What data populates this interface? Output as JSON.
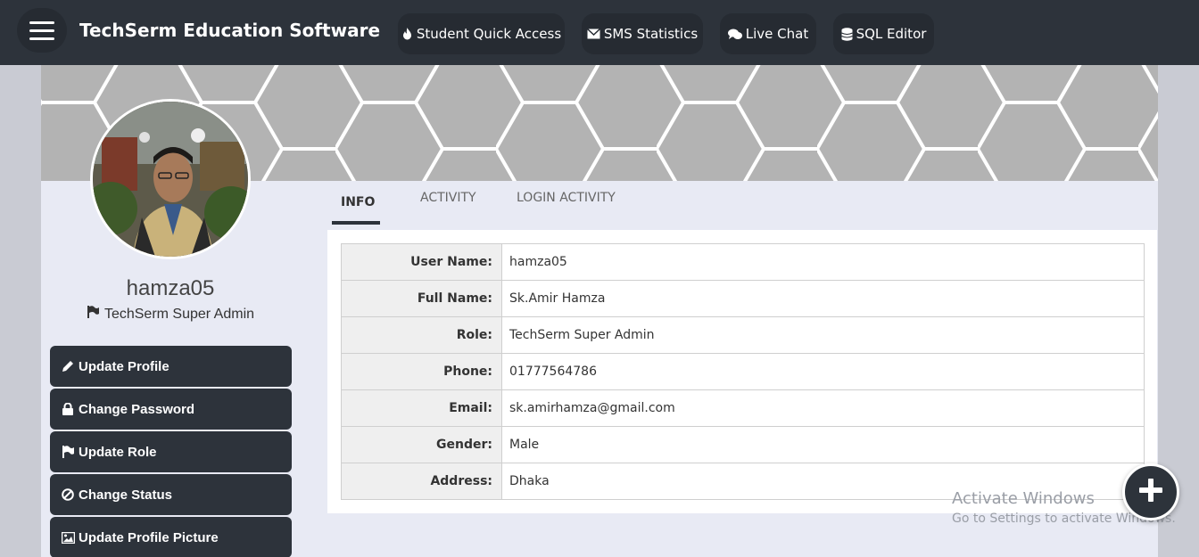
{
  "navbar": {
    "brand": "TechSerm Education Software",
    "items": [
      {
        "label": "Student Quick Access",
        "icon": "fire-icon"
      },
      {
        "label": "SMS Statistics",
        "icon": "envelope-icon"
      },
      {
        "label": "Live Chat",
        "icon": "chat-icon"
      },
      {
        "label": "SQL Editor",
        "icon": "database-icon"
      }
    ]
  },
  "profile": {
    "username": "hamza05",
    "role": "TechSerm Super Admin"
  },
  "actions": [
    {
      "label": "Update Profile",
      "icon": "pencil-icon"
    },
    {
      "label": "Change Password",
      "icon": "lock-icon"
    },
    {
      "label": "Update Role",
      "icon": "flag-icon"
    },
    {
      "label": "Change Status",
      "icon": "ban-icon"
    },
    {
      "label": "Update Profile Picture",
      "icon": "image-icon"
    }
  ],
  "tabs": [
    {
      "label": "INFO",
      "active": true
    },
    {
      "label": "ACTIVITY",
      "active": false
    },
    {
      "label": "LOGIN ACTIVITY",
      "active": false
    }
  ],
  "info": [
    {
      "label": "User Name:",
      "value": "hamza05"
    },
    {
      "label": "Full Name:",
      "value": "Sk.Amir Hamza"
    },
    {
      "label": "Role:",
      "value": "TechSerm Super Admin"
    },
    {
      "label": "Phone:",
      "value": "01777564786"
    },
    {
      "label": "Email:",
      "value": "sk.amirhamza@gmail.com"
    },
    {
      "label": "Gender:",
      "value": "Male"
    },
    {
      "label": "Address:",
      "value": "Dhaka"
    }
  ],
  "watermark": {
    "line1": "Activate Windows",
    "line2": "Go to Settings to activate Windows."
  },
  "colors": {
    "navbar": "#2d333b",
    "panel": "#e8eaf4",
    "button": "#2d333b"
  }
}
